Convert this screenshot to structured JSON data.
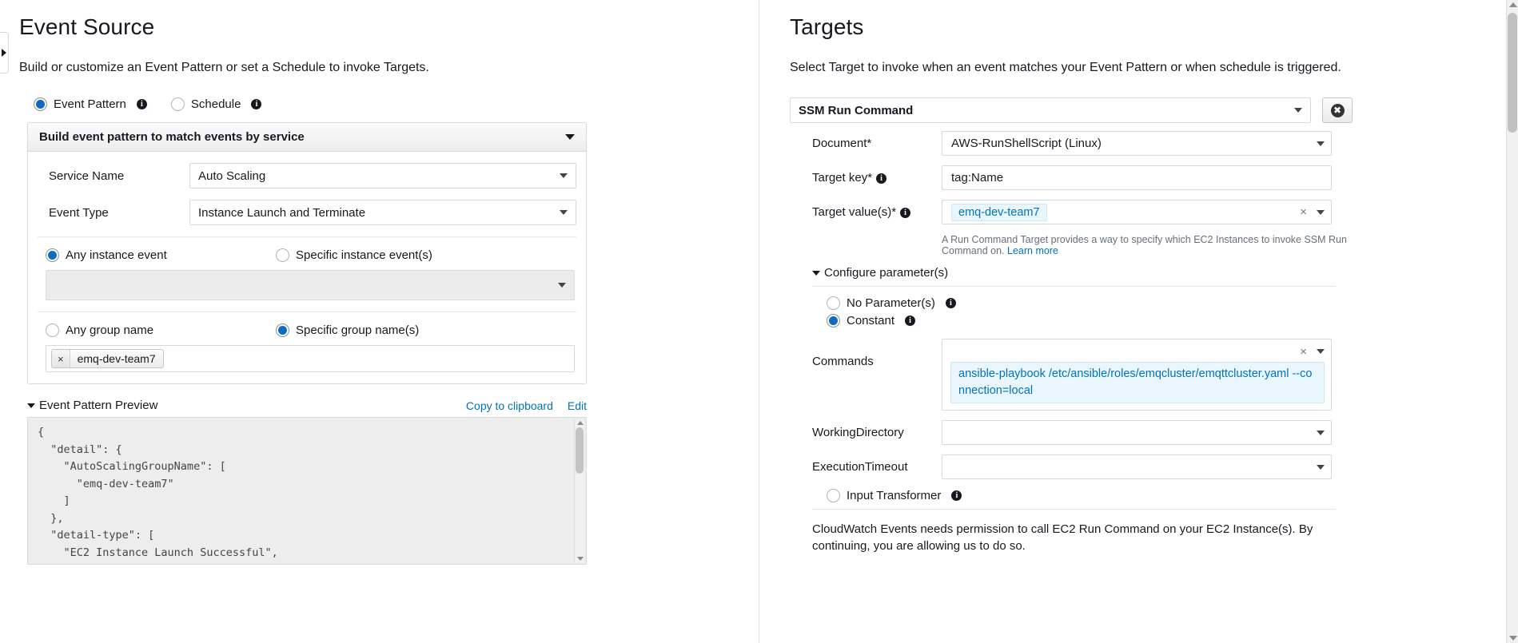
{
  "event_source": {
    "title": "Event Source",
    "subtitle": "Build or customize an Event Pattern or set a Schedule to invoke Targets.",
    "mode_radios": [
      {
        "label": "Event Pattern",
        "checked": true,
        "info": true
      },
      {
        "label": "Schedule",
        "checked": false,
        "info": true
      }
    ],
    "accordion_title": "Build event pattern to match events by service",
    "fields": [
      {
        "label": "Service Name",
        "value": "Auto Scaling"
      },
      {
        "label": "Event Type",
        "value": "Instance Launch and Terminate"
      }
    ],
    "instance_event_radios": [
      {
        "label": "Any instance event",
        "checked": true
      },
      {
        "label": "Specific instance event(s)",
        "checked": false
      }
    ],
    "instance_event_select_value": "",
    "group_name_radios": [
      {
        "label": "Any group name",
        "checked": false
      },
      {
        "label": "Specific group name(s)",
        "checked": true
      }
    ],
    "group_tokens": [
      {
        "label": "emq-dev-team7",
        "remove": "×"
      }
    ],
    "preview": {
      "title": "Event Pattern Preview",
      "copy_label": "Copy to clipboard",
      "edit_label": "Edit",
      "json": "{\n  \"detail\": {\n    \"AutoScalingGroupName\": [\n      \"emq-dev-team7\"\n    ]\n  },\n  \"detail-type\": [\n    \"EC2 Instance Launch Successful\","
    }
  },
  "targets": {
    "title": "Targets",
    "subtitle": "Select Target to invoke when an event matches your Event Pattern or when schedule is triggered.",
    "target_type": "SSM Run Command",
    "remove_button_glyph": "✖",
    "fields": [
      {
        "label": "Document*",
        "value": "AWS-RunShellScript (Linux)",
        "info": false,
        "type": "select"
      },
      {
        "label": "Target key*",
        "value": "tag:Name",
        "info": true,
        "type": "text"
      }
    ],
    "target_value_label": "Target value(s)*",
    "target_value_token": "emq-dev-team7",
    "clear_glyph": "×",
    "run_command_hint": "A Run Command Target provides a way to specify which EC2 Instances to invoke SSM Run Command on.",
    "learn_more_label": "Learn more",
    "configure_parameters_label": "Configure parameter(s)",
    "parameter_radios": [
      {
        "label": "No Parameter(s)",
        "checked": false,
        "info": true
      },
      {
        "label": "Constant",
        "checked": true,
        "info": true
      }
    ],
    "commands_label": "Commands",
    "commands_token": "ansible-playbook /etc/ansible/roles/emqcluster/emqttcluster.yaml --connection=local",
    "working_directory_label": "WorkingDirectory",
    "working_directory_value": "",
    "execution_timeout_label": "ExecutionTimeout",
    "execution_timeout_value": "",
    "input_transformer": {
      "label": "Input Transformer",
      "checked": false,
      "info": true
    },
    "permission_note": "CloudWatch Events needs permission to call EC2 Run Command on your EC2 Instance(s). By continuing, you are allowing us to do so."
  },
  "colors": {
    "accent_blue": "#0f6bbd",
    "link_blue": "#0073bb",
    "token_blue_bg": "#eaf6fd",
    "panel_gray": "#ededed",
    "border_gray": "#d5dbdb"
  }
}
